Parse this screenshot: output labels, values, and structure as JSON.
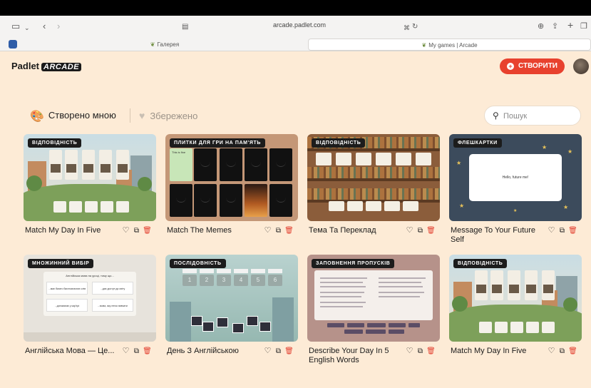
{
  "browser": {
    "url": "arcade.padlet.com",
    "tabs": [
      {
        "label": "Галерея"
      },
      {
        "label": "My games | Arcade"
      }
    ]
  },
  "header": {
    "brand": "Padlet",
    "brand_badge": "ARCADE",
    "create_label": "СТВОРИТИ"
  },
  "filters": {
    "mine": "Створено мною",
    "saved": "Збережено"
  },
  "search": {
    "placeholder": "Пошук"
  },
  "cards": [
    {
      "tag": "ВІДПОВІДНІСТЬ",
      "title": "Match My Day In Five",
      "thumb": "village"
    },
    {
      "tag": "ПЛИТКИ ДЛЯ ГРИ НА ПАМ'ЯТЬ",
      "title": "Match The Memes",
      "thumb": "memes",
      "thumb_text": "This is fine"
    },
    {
      "tag": "ВІДПОВІДНІСТЬ",
      "title": "Тема Та Переклад",
      "thumb": "library"
    },
    {
      "tag": "ФЛЕШКАРТКИ",
      "title": "Message To Your Future Self",
      "thumb": "night",
      "thumb_text": "Hello, future me!"
    },
    {
      "tag": "МНОЖИННИЙ ВИБІР",
      "title": "Англійська Мова — Це...",
      "thumb": "choice",
      "thumb_text": "Англійська мова на уроці, тому що...",
      "thumb_options": [
        "...має багато багатозначних слів",
        "...дає доступ до світу",
        "...допомагає у кар'єрі",
        "...мова, яку легко вивчати"
      ]
    },
    {
      "tag": "ПОСЛІДОВНІСТЬ",
      "title": "День З Англійською",
      "thumb": "sequence",
      "thumb_numbers": [
        "1",
        "2",
        "3",
        "4",
        "5",
        "6"
      ]
    },
    {
      "tag": "ЗАПОВНЕННЯ ПРОПУСКІВ",
      "title": "Describe Your Day In 5 English Words",
      "thumb": "fill"
    },
    {
      "tag": "ВІДПОВІДНІСТЬ",
      "title": "Match My Day In Five",
      "thumb": "village"
    }
  ],
  "colors": {
    "page_bg": "#fdebd6",
    "accent": "#e8412e",
    "delete": "#e23d2d"
  }
}
